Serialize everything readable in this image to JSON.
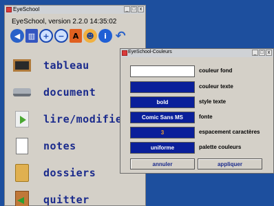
{
  "main_window": {
    "title": "EyeSchool",
    "window_buttons": [
      "_",
      "□",
      "x"
    ],
    "version_line": "EyeSchool, version 2.2.0   14:35:02",
    "toolbar": [
      {
        "icon": "speaker-icon",
        "glyph": "◀"
      },
      {
        "icon": "book-icon",
        "glyph": "▥"
      },
      {
        "icon": "zoom-in-icon",
        "glyph": "+"
      },
      {
        "icon": "zoom-out-icon",
        "glyph": "−"
      },
      {
        "icon": "font-icon",
        "glyph": "A"
      },
      {
        "icon": "user-icon",
        "glyph": "☻"
      },
      {
        "icon": "info-icon",
        "glyph": "i"
      },
      {
        "icon": "undo-icon",
        "glyph": "↶"
      }
    ],
    "menu": [
      {
        "label": "tableau",
        "icon": "blackboard-icon"
      },
      {
        "label": "document",
        "icon": "scanner-icon"
      },
      {
        "label": "lire/modifie",
        "icon": "play-document-icon"
      },
      {
        "label": "notes",
        "icon": "notes-icon"
      },
      {
        "label": "dossiers",
        "icon": "folder-icon"
      },
      {
        "label": "quitter",
        "icon": "exit-door-icon"
      }
    ]
  },
  "colors_dialog": {
    "title": "EyeSchool-Couleurs",
    "window_buttons": [
      "_",
      "□",
      "x"
    ],
    "rows": [
      {
        "value": "",
        "label": "couleur fond",
        "swatch_color": "#ffffff"
      },
      {
        "value": "",
        "label": "couleur texte",
        "swatch_color": "#0a1f9a"
      },
      {
        "value": "bold",
        "label": "style texte",
        "swatch_color": "#0a1f9a"
      },
      {
        "value": "Comic Sans MS",
        "label": "fonte",
        "swatch_color": "#0a1f9a"
      },
      {
        "value": "3",
        "label": "espacement caractères",
        "swatch_color": "#0a1f9a"
      },
      {
        "value": "uniforme",
        "label": "palette couleurs",
        "swatch_color": "#0a1f9a"
      }
    ],
    "cancel_label": "annuler",
    "apply_label": "appliquer"
  },
  "colors": {
    "desktop": "#1d4f9e",
    "menu_text": "#1a2a8c",
    "dialog_swatch": "#0a1f9a"
  }
}
